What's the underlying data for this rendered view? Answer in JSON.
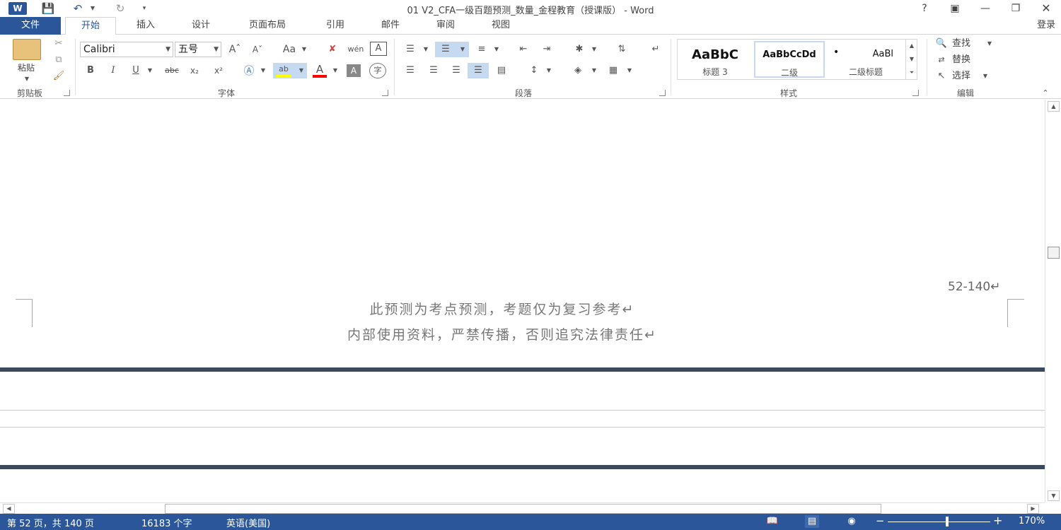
{
  "titlebar": {
    "title": "01 V2_CFA一级百题预测_数量_金程教育（授课版） - Word",
    "word_icon": "word-app-icon",
    "save_icon": "save-icon",
    "undo_icon": "undo-icon",
    "redo_icon": "redo-icon",
    "customize_icon": "customize-quick-access-icon",
    "help": "?",
    "signin": "登录"
  },
  "tabs": [
    "文件",
    "开始",
    "插入",
    "设计",
    "页面布局",
    "引用",
    "邮件",
    "审阅",
    "视图"
  ],
  "ribbon": {
    "clipboard": {
      "label": "剪贴板",
      "paste": "粘贴"
    },
    "font": {
      "label": "字体",
      "font_name": "Calibri",
      "font_size": "五号",
      "change_case": "Aa",
      "bold": "B",
      "italic": "I",
      "underline": "U",
      "strike": "abc",
      "subscript": "x₂",
      "superscript": "x²",
      "phonetic": "wén",
      "enclose": "字"
    },
    "paragraph": {
      "label": "段落"
    },
    "styles": {
      "label": "样式",
      "items": [
        {
          "sample": "AaBbC",
          "name": "标题 3"
        },
        {
          "sample": "AaBbCcDd",
          "name": "二级"
        },
        {
          "sample": "AaBl",
          "name": "二级标题"
        }
      ]
    },
    "editing": {
      "label": "编辑",
      "find": "查找",
      "replace": "替换",
      "select": "选择"
    }
  },
  "document": {
    "page_number": "52-140↵",
    "notice_line1": "此预测为考点预测，考题仅为复习参考↵",
    "notice_line2": "内部使用资料，严禁传播，否则追究法律责任↵"
  },
  "status": {
    "page": "第 52 页，共 140 页",
    "words": "16183 个字",
    "language": "英语(美国)",
    "zoom": "170%",
    "zoom_minus": "−",
    "zoom_plus": "+",
    "zoom_value_percent": 170
  },
  "colors": {
    "accent": "#2b579a",
    "highlight_yellow": "#ffff00",
    "font_red": "#ff0000"
  }
}
